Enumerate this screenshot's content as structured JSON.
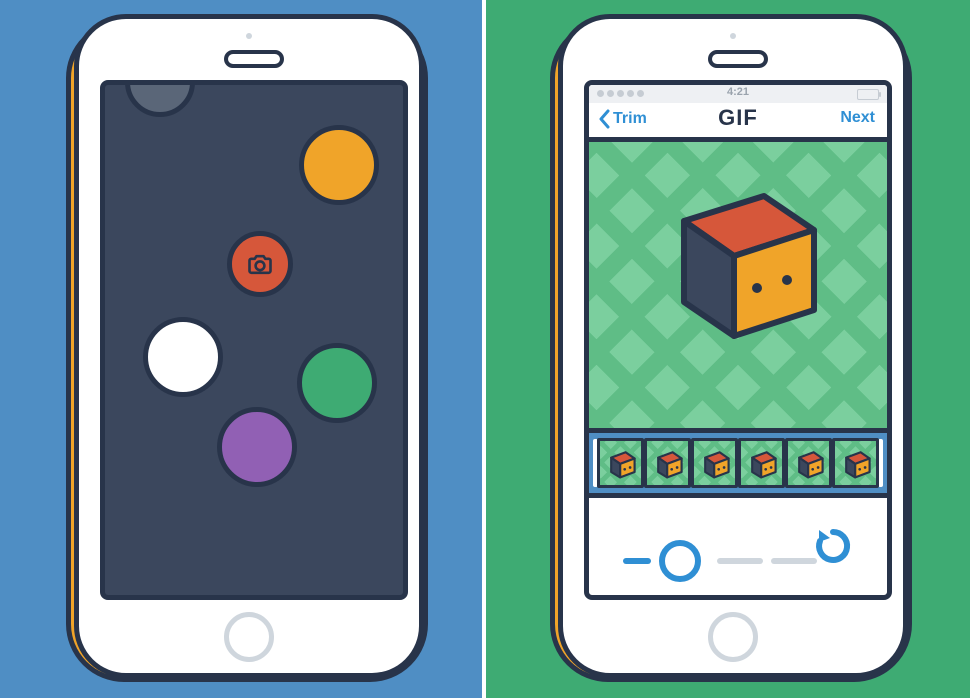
{
  "left": {
    "dots": {
      "grey": "#5a6678",
      "orange": "#f0a429",
      "white": "#ffffff",
      "green": "#3eab73",
      "purple": "#9160b4",
      "camera": "#d6573a"
    }
  },
  "right": {
    "status": {
      "time": "4:21"
    },
    "nav": {
      "back": "Trim",
      "title": "GIF",
      "next": "Next"
    },
    "filmstrip": {
      "frame_count": 6
    }
  },
  "colors": {
    "outline": "#28344a",
    "accent_blue": "#2f8fd4",
    "phone_orange": "#f0a429",
    "bg_left": "#4f8ec4",
    "bg_right": "#3eab73"
  }
}
